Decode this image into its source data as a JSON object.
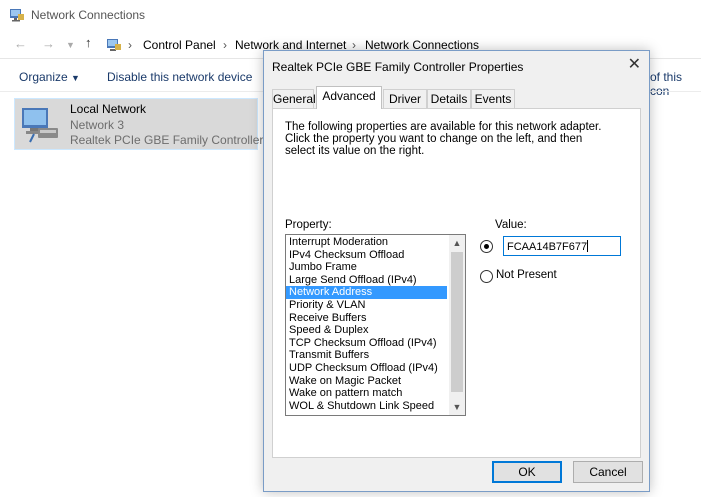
{
  "explorer": {
    "window_title": "Network Connections",
    "breadcrumbs": [
      "Control Panel",
      "Network and Internet",
      "Network Connections"
    ],
    "commands": {
      "organize": "Organize",
      "disable": "Disable this network device",
      "overflow_clip": "of this con"
    },
    "item": {
      "name": "Local Network",
      "network": "Network  3",
      "adapter": "Realtek PCIe GBE Family Controller"
    }
  },
  "dialog": {
    "title": "Realtek PCIe GBE Family Controller Properties",
    "tabs": [
      "General",
      "Advanced",
      "Driver",
      "Details",
      "Events"
    ],
    "active_tab": "Advanced",
    "description": "The following properties are available for this network adapter. Click the property you want to change on the left, and then select its value on the right.",
    "property_label": "Property:",
    "value_label": "Value:",
    "properties": [
      "Interrupt Moderation",
      "IPv4 Checksum Offload",
      "Jumbo Frame",
      "Large Send Offload (IPv4)",
      "Network Address",
      "Priority & VLAN",
      "Receive Buffers",
      "Speed & Duplex",
      "TCP Checksum Offload (IPv4)",
      "Transmit Buffers",
      "UDP Checksum Offload (IPv4)",
      "Wake on Magic Packet",
      "Wake on pattern match",
      "WOL & Shutdown Link Speed"
    ],
    "selected_property": "Network Address",
    "value": "FCAA14B7F677",
    "not_present_label": "Not Present",
    "ok_label": "OK",
    "cancel_label": "Cancel"
  },
  "colors": {
    "selection": "#3399ff",
    "accent": "#0078d7",
    "item_highlight": "#d9d9d9"
  }
}
